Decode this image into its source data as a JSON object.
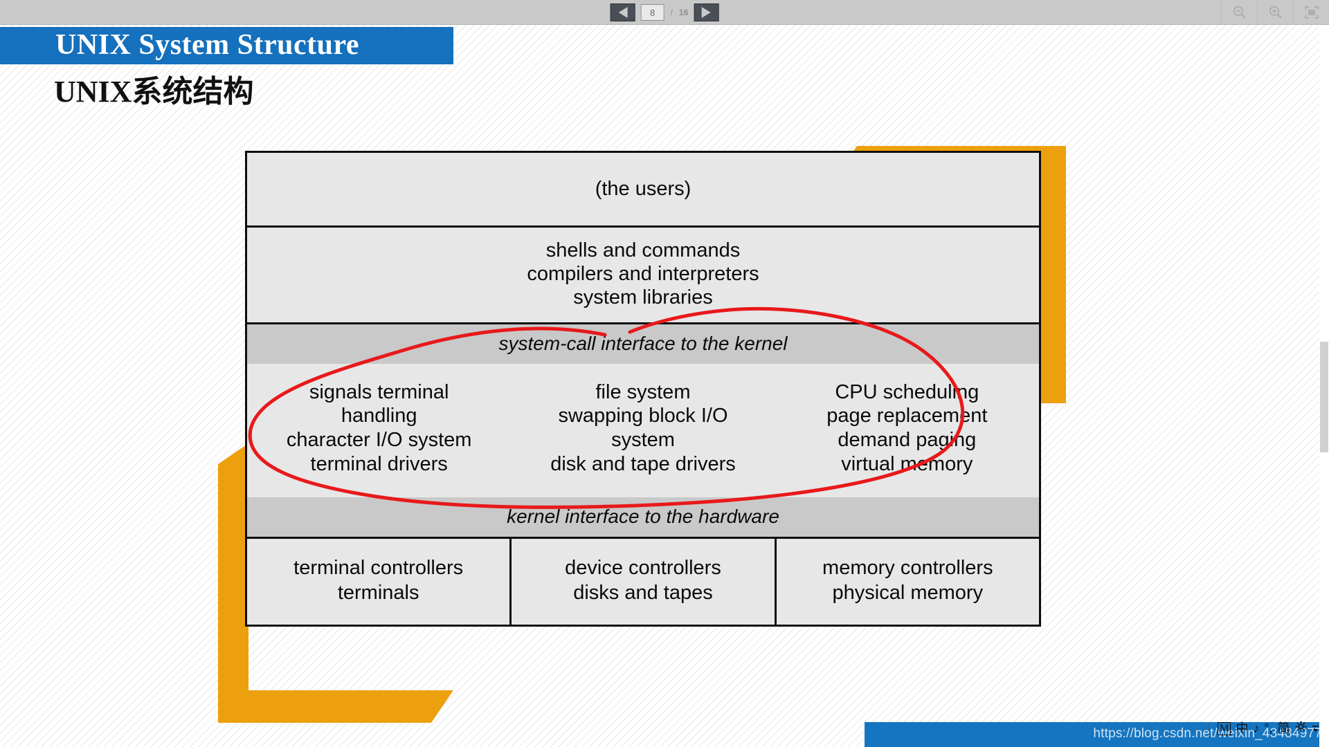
{
  "toolbar": {
    "prev_label": "◀",
    "next_label": "▶",
    "current_page": "8",
    "separator": "/",
    "total_pages": "16",
    "zoom_out_icon": "zoom-out-icon",
    "zoom_in_icon": "zoom-in-icon",
    "fullscreen_icon": "fullscreen-icon"
  },
  "slide": {
    "title_en": "UNIX System Structure",
    "title_cn": "UNIX系统结构",
    "title_band_color": "#1570bd",
    "accent_color": "#eda00d",
    "annotation_color": "#e8191b"
  },
  "diagram": {
    "users_row": "(the users)",
    "shells_row": [
      "shells and commands",
      "compilers and interpreters",
      "system libraries"
    ],
    "syscall_band": "system-call interface to the kernel",
    "kernel_columns": [
      [
        "signals terminal",
        "handling",
        "character I/O system",
        "terminal drivers"
      ],
      [
        "file system",
        "swapping block I/O",
        "system",
        "disk and tape drivers"
      ],
      [
        "CPU scheduling",
        "page replacement",
        "demand paging",
        "virtual memory"
      ]
    ],
    "hardware_band": "kernel interface to the hardware",
    "hardware_columns": [
      [
        "terminal controllers",
        "terminals"
      ],
      [
        "device controllers",
        "disks and tapes"
      ],
      [
        "memory controllers",
        "physical memory"
      ]
    ]
  },
  "watermark": {
    "url": "https://blog.csdn.net/weixin_43484977"
  },
  "ime": {
    "mode_badge": "M",
    "language": "中",
    "tone_glyph": "♪",
    "punct_glyph": "°,",
    "script": "简",
    "settings_icon": "gear-icon",
    "expand_icon": "chevron-updown-icon"
  }
}
